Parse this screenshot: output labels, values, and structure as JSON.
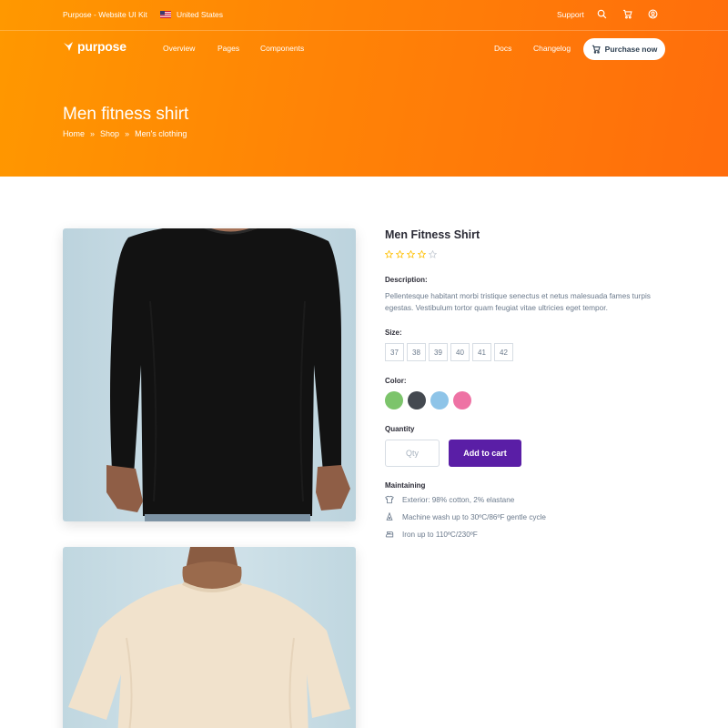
{
  "topbar": {
    "brand": "Purpose - Website UI Kit",
    "country": "United States",
    "support": "Support",
    "icons": [
      "search-icon",
      "cart-icon",
      "user-icon"
    ]
  },
  "navbar": {
    "logo": "purpose",
    "links": [
      "Overview",
      "Pages",
      "Components"
    ],
    "right_links": [
      "Docs",
      "Changelog"
    ],
    "purchase": "Purchase now"
  },
  "header": {
    "title": "Men fitness shirt",
    "breadcrumb": [
      "Home",
      "Shop",
      "Men's clothing"
    ],
    "separator": "»"
  },
  "product": {
    "name": "Men Fitness Shirt",
    "rating": 4,
    "rating_max": 5,
    "description_label": "Description:",
    "description": "Pellentesque habitant morbi tristique senectus et netus malesuada fames turpis egestas. Vestibulum tortor quam feugiat vitae ultricies eget tempor.",
    "size_label": "Size:",
    "sizes": [
      "37",
      "38",
      "39",
      "40",
      "41",
      "42"
    ],
    "color_label": "Color:",
    "colors": [
      "#7cc46b",
      "#444950",
      "#8ec4e8",
      "#ee72a4"
    ],
    "quantity_label": "Quantity",
    "quantity_placeholder": "Qty",
    "add_to_cart": "Add to cart",
    "maintaining_label": "Maintaining",
    "care": [
      {
        "icon": "shirt-icon",
        "text": "Exterior: 98% cotton, 2% elastane"
      },
      {
        "icon": "wash-icon",
        "text": "Machine wash up to 30ºC/86ºF gentle cycle"
      },
      {
        "icon": "iron-icon",
        "text": "Iron up to 110ºC/230ºF"
      }
    ]
  },
  "colors": {
    "hero_start": "#ff9800",
    "hero_end": "#ff6d0c",
    "primary_button": "#5a1ea6",
    "star": "#ffc107"
  }
}
